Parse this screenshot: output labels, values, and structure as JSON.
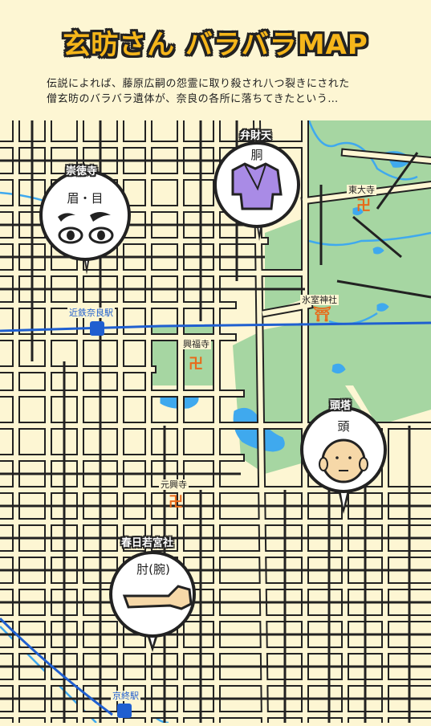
{
  "title": "玄昉さん バラバラMAP",
  "intro": {
    "line1": "伝説によれば、藤原広嗣の怨霊に取り殺され八つ裂きにされた",
    "line2": "僧玄昉のバラバラ遺体が、奈良の各所に落ちてきたという…"
  },
  "places": {
    "todaiji": "東大寺",
    "himuro": "氷室神社",
    "kofukuji": "興福寺",
    "gangoji": "元興寺",
    "kintetsu": "近鉄奈良駅",
    "kyobate": "京終駅"
  },
  "pins": {
    "sutokuji": {
      "name": "崇徳寺",
      "part": "眉・目"
    },
    "benzaiten": {
      "name": "弁財天",
      "part": "胴"
    },
    "zuto": {
      "name": "頭塔",
      "part": "頭"
    },
    "kasuga": {
      "name": "春日若宮社",
      "part": "肘(腕)"
    }
  },
  "symbols": {
    "temple": "卍",
    "shrine": "⛩"
  },
  "colors": {
    "land": "#FDF6D3",
    "park": "#A6D6A2",
    "water": "#3FA9EE",
    "rail": "#1F5FD0",
    "accent": "#F5B61A",
    "temple": "#E86A1A",
    "robe": "#A98BE6"
  }
}
